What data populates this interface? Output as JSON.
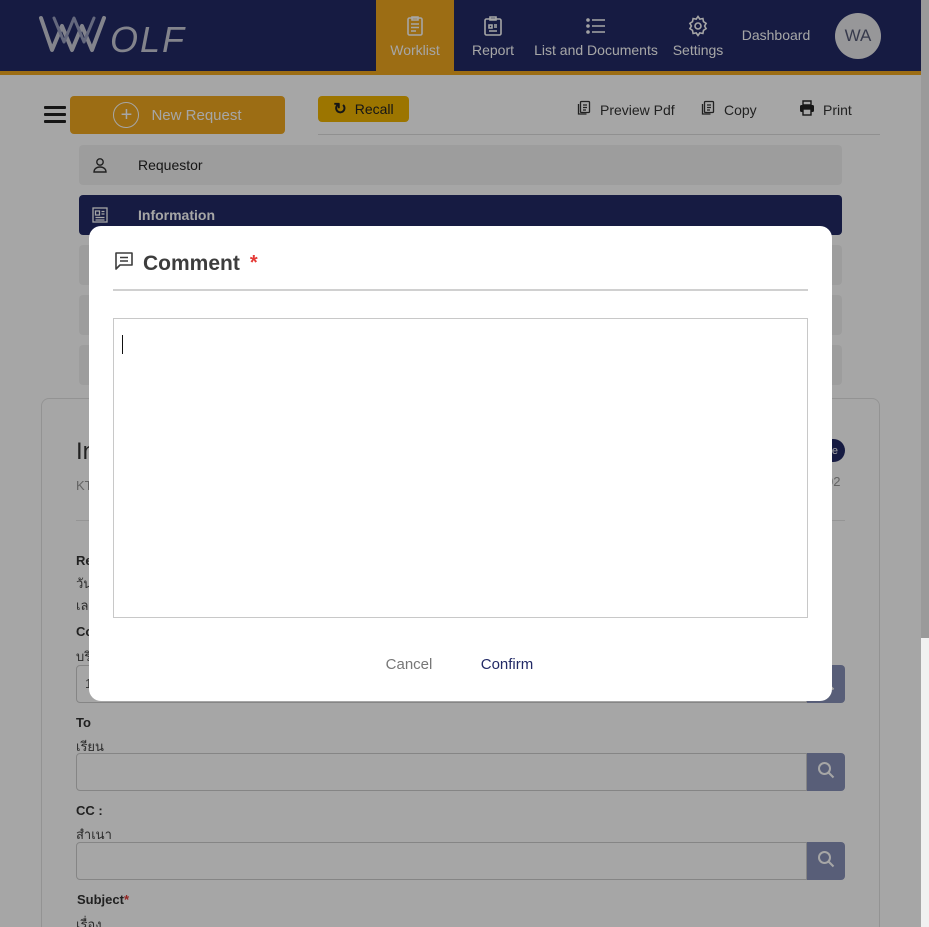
{
  "app": {
    "logo_text": "WOLF"
  },
  "nav": {
    "items": [
      {
        "label": "Worklist",
        "icon": "clipboard-icon",
        "active": true
      },
      {
        "label": "Report",
        "icon": "report-icon"
      },
      {
        "label": "List and Documents",
        "icon": "list-icon"
      },
      {
        "label": "Settings",
        "icon": "gear-icon"
      }
    ],
    "dashboard": "Dashboard",
    "avatar_initials": "WA"
  },
  "colors": {
    "nav_bg": "#222a66",
    "accent": "#f0a81f",
    "danger": "#e53935",
    "search_btn": "#8891b8"
  },
  "toolbar": {
    "new_request": "New Request",
    "recall": "Recall",
    "preview_pdf": "Preview Pdf",
    "copy": "Copy",
    "print": "Print"
  },
  "sidebar": {
    "items": [
      {
        "label": "Requestor",
        "icon": "user-icon"
      },
      {
        "label": "Information",
        "icon": "document-icon",
        "active": true
      }
    ]
  },
  "form": {
    "title_partial": "In",
    "subtitle_partial": "KT",
    "badge_partial": "e",
    "right_num_partial": "02",
    "fields": [
      {
        "label": "Re",
        "sub": [
          "วัน",
          "เล"
        ]
      },
      {
        "label": "Co",
        "sub": "บริ"
      },
      {
        "label": "To",
        "sub": "เรียน"
      },
      {
        "label": "CC :",
        "sub": "สำเนา"
      },
      {
        "label": "Subject",
        "required_mark": "*",
        "sub": "เรื่อง"
      }
    ],
    "company_input_partial": "1"
  },
  "modal": {
    "title": "Comment",
    "required_mark": "*",
    "comment_value": "",
    "cancel": "Cancel",
    "confirm": "Confirm"
  }
}
